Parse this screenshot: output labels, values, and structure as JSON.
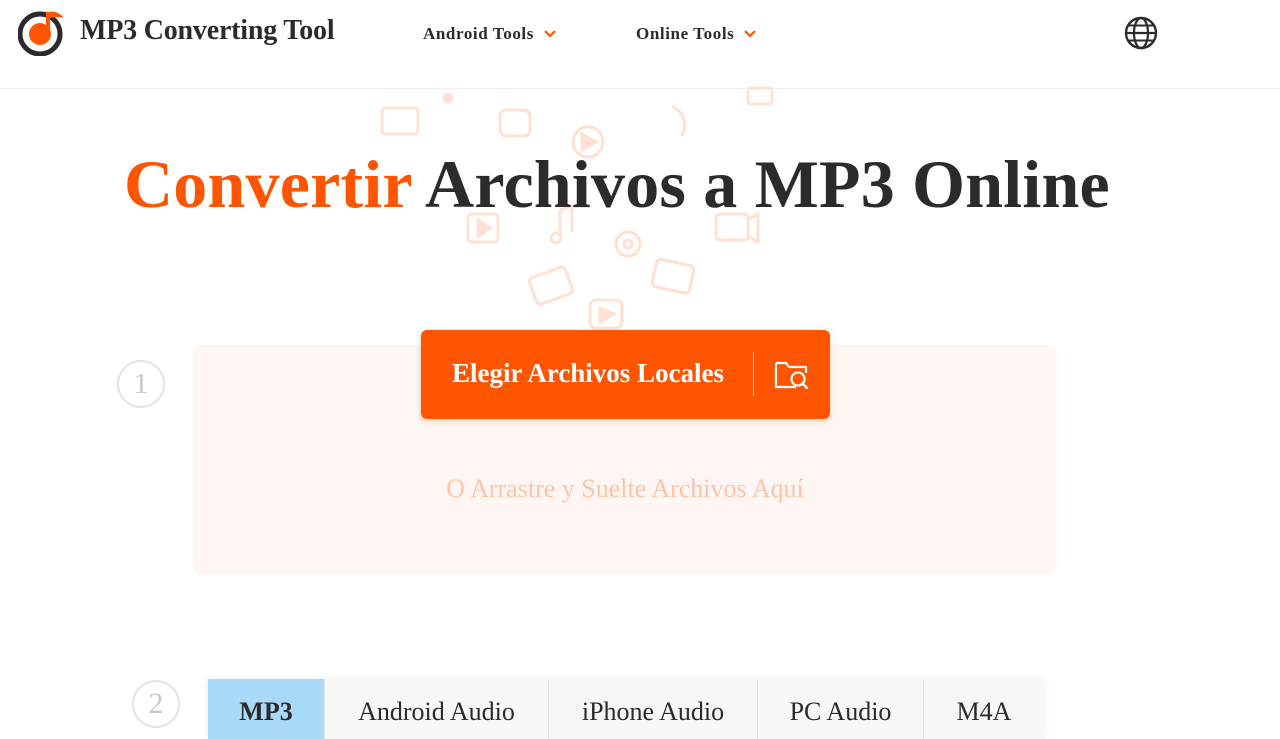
{
  "header": {
    "brand": "MP3 Converting Tool",
    "nav": [
      {
        "label": "Android Tools"
      },
      {
        "label": "Online Tools"
      }
    ]
  },
  "hero": {
    "title_accent": "Convertir",
    "title_rest": "Archivos a MP3 Online"
  },
  "upload": {
    "step": "1",
    "button_label": "Elegir Archivos Locales",
    "drop_hint": "O Arrastre y Suelte Archivos Aquí"
  },
  "formats": {
    "step": "2",
    "tabs": [
      {
        "label": "MP3",
        "active": true
      },
      {
        "label": "Android Audio",
        "active": false
      },
      {
        "label": "iPhone Audio",
        "active": false
      },
      {
        "label": "PC Audio",
        "active": false
      },
      {
        "label": "M4A",
        "active": false
      }
    ]
  },
  "colors": {
    "accent": "#ff5500",
    "active_tab": "#a9d9f9",
    "dropzone_bg": "#fff6f3"
  },
  "icons": [
    "logo-music-icon",
    "chevron-down-icon",
    "globe-icon",
    "folder-search-icon"
  ]
}
